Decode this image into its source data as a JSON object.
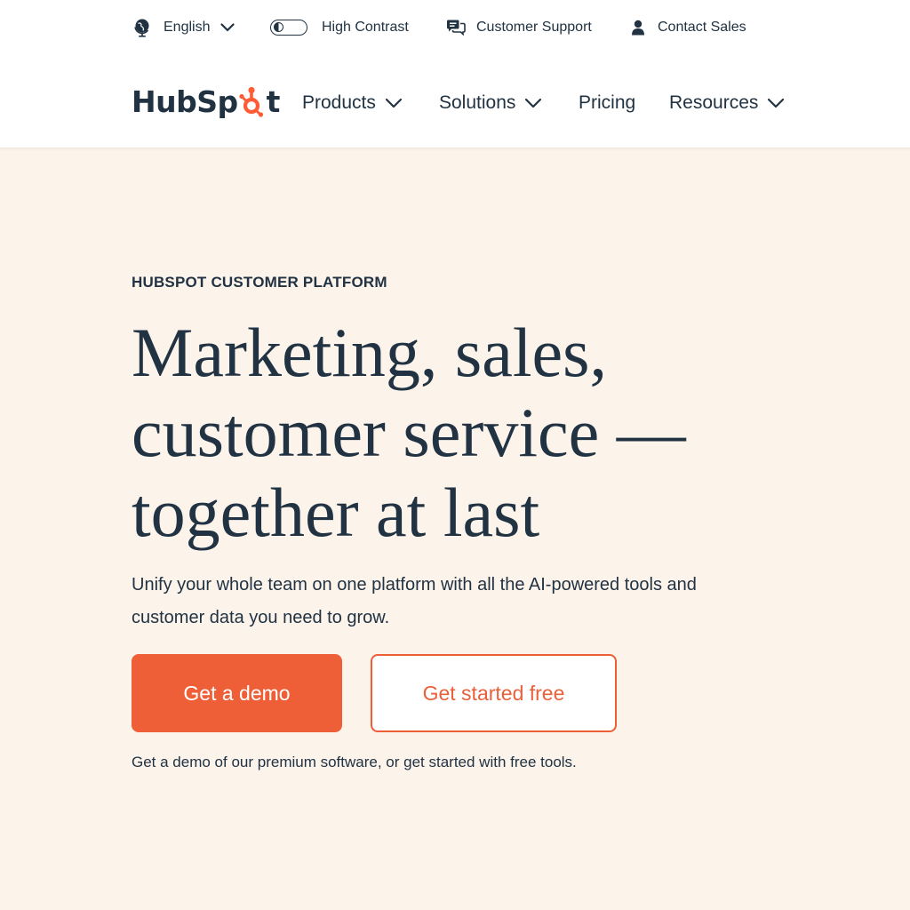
{
  "utility": {
    "language": "English",
    "high_contrast": "High Contrast",
    "high_contrast_on": false,
    "support": "Customer Support",
    "sales": "Contact Sales"
  },
  "brand": {
    "logo_left": "HubSp",
    "logo_right": "t",
    "accent": "#ff5c35",
    "text": "#213343",
    "hero_bg": "#fcf3eb"
  },
  "nav": {
    "products": "Products",
    "solutions": "Solutions",
    "pricing": "Pricing",
    "resources": "Resources"
  },
  "hero": {
    "eyebrow": "HUBSPOT CUSTOMER PLATFORM",
    "headline_lines": [
      "Marketing, sales,",
      "customer service —",
      "together at last"
    ],
    "subtext": "Unify your whole team on one platform with all the AI-powered tools and customer data you need to grow.",
    "primary_button": "Get a demo",
    "secondary_button": "Get started free",
    "note": "Get a demo of our premium software, or get started with free tools."
  },
  "icons": {
    "language": "globe-icon",
    "support": "chat-icon",
    "sales": "person-icon",
    "dropdown": "chevron-down-icon"
  }
}
